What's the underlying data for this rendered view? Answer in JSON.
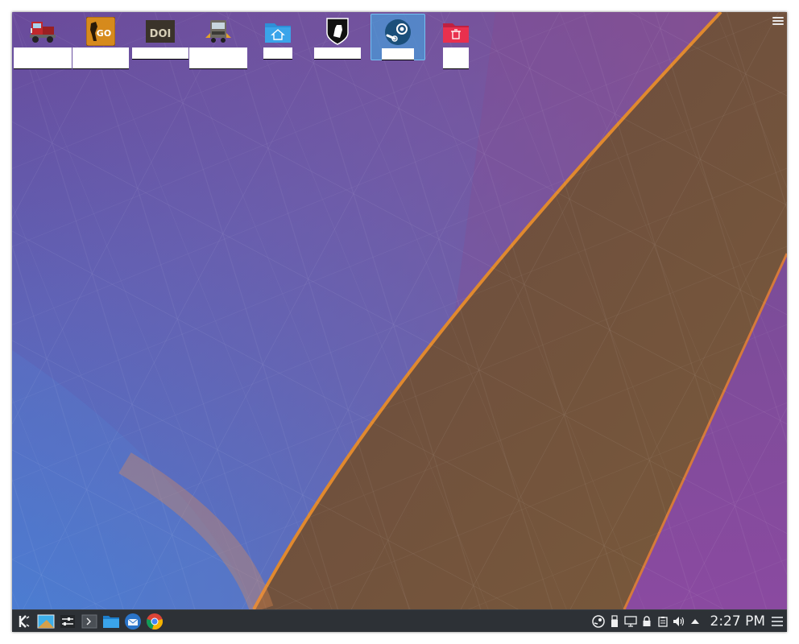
{
  "desktop": {
    "icons": [
      {
        "name": "truck-game-icon",
        "label": ""
      },
      {
        "name": "csgo-icon",
        "label": ""
      },
      {
        "name": "doi-icon",
        "label": ""
      },
      {
        "name": "euro-truck-icon",
        "label": ""
      },
      {
        "name": "home-folder-icon",
        "label": ""
      },
      {
        "name": "fist-shield-icon",
        "label": ""
      },
      {
        "name": "steam-icon",
        "label": ""
      },
      {
        "name": "trash-icon",
        "label": ""
      }
    ],
    "csgo_badge": "GO",
    "doi_badge": "DOI",
    "selected_icon_index": 6
  },
  "taskbar": {
    "launchers": [
      "kde-menu-icon",
      "desktop-pager-icon",
      "system-settings-icon",
      "terminal-icon",
      "file-manager-icon",
      "thunderbird-icon",
      "chrome-icon"
    ],
    "tray": [
      "steam-tray-icon",
      "usb-icon",
      "display-icon",
      "lock-icon",
      "clipboard-icon",
      "volume-icon",
      "expand-tray-icon"
    ],
    "clock": "2:27 PM"
  },
  "colors": {
    "panel": "#2d3136",
    "selection": "#3daee9",
    "folder": "#3aa4ea",
    "trash_folder": "#e9304e"
  }
}
